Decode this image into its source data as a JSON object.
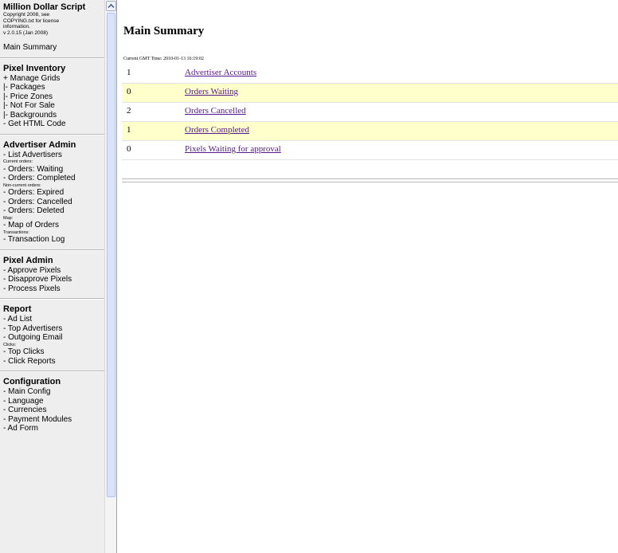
{
  "sidebar": {
    "app_title": "Million Dollar Script",
    "copyright": [
      "Copyright 2008, see",
      "COPYING.txt for license",
      "information."
    ],
    "version": "v 2.0.15 (Jan 2008)",
    "main_summary": "Main Summary",
    "sections": [
      {
        "heading": "Pixel Inventory",
        "entries": [
          {
            "type": "link",
            "text": "+ Manage Grids"
          },
          {
            "type": "link",
            "text": "|- Packages"
          },
          {
            "type": "link",
            "text": "|- Price Zones"
          },
          {
            "type": "link",
            "text": "|- Not For Sale"
          },
          {
            "type": "link",
            "text": "|- Backgrounds"
          },
          {
            "type": "link",
            "text": "- Get HTML Code"
          }
        ]
      },
      {
        "heading": "Advertiser Admin",
        "entries": [
          {
            "type": "link",
            "text": "- List Advertisers"
          },
          {
            "type": "label",
            "text": "Current orders:"
          },
          {
            "type": "link",
            "text": "- Orders: Waiting"
          },
          {
            "type": "link",
            "text": "- Orders: Completed"
          },
          {
            "type": "label",
            "text": "Non-current orders:"
          },
          {
            "type": "link",
            "text": "- Orders: Expired"
          },
          {
            "type": "link",
            "text": "- Orders: Cancelled"
          },
          {
            "type": "link",
            "text": "- Orders: Deleted"
          },
          {
            "type": "label",
            "text": "Map:"
          },
          {
            "type": "link",
            "text": "- Map of Orders"
          },
          {
            "type": "label",
            "text": "Transactions:"
          },
          {
            "type": "link",
            "text": "- Transaction Log"
          }
        ]
      },
      {
        "heading": "Pixel Admin",
        "entries": [
          {
            "type": "link",
            "text": "- Approve Pixels"
          },
          {
            "type": "link",
            "text": "- Disapprove Pixels"
          },
          {
            "type": "link",
            "text": "- Process Pixels"
          }
        ]
      },
      {
        "heading": "Report",
        "entries": [
          {
            "type": "link",
            "text": "- Ad List"
          },
          {
            "type": "link",
            "text": "- Top Advertisers"
          },
          {
            "type": "link",
            "text": "- Outgoing Email"
          },
          {
            "type": "label",
            "text": "Clicks:"
          },
          {
            "type": "link",
            "text": "- Top Clicks"
          },
          {
            "type": "link",
            "text": "- Click Reports"
          }
        ]
      },
      {
        "heading": "Configuration",
        "entries": [
          {
            "type": "link",
            "text": "- Main Config"
          },
          {
            "type": "link",
            "text": "- Language"
          },
          {
            "type": "link",
            "text": "- Currencies"
          },
          {
            "type": "link",
            "text": "- Payment Modules"
          },
          {
            "type": "link",
            "text": "- Ad Form"
          }
        ]
      }
    ]
  },
  "main": {
    "title": "Main Summary",
    "gmt_label": "Current GMT Time: 2010-01-13 16:19:02",
    "rows": [
      {
        "count": "1",
        "label": "Advertiser Accounts",
        "highlight": false
      },
      {
        "count": "0",
        "label": "Orders Waiting",
        "highlight": true
      },
      {
        "count": "2",
        "label": "Orders Cancelled",
        "highlight": false
      },
      {
        "count": "1",
        "label": "Orders Completed",
        "highlight": true
      },
      {
        "count": "0",
        "label": "Pixels Waiting for approval",
        "highlight": false
      }
    ]
  },
  "colors": {
    "sidebar_bg": "#eeeeee",
    "row_highlight": "#ffffcc",
    "visited_link": "#551a8b"
  },
  "icons": {
    "scroll_up": "chevron-up-icon"
  }
}
